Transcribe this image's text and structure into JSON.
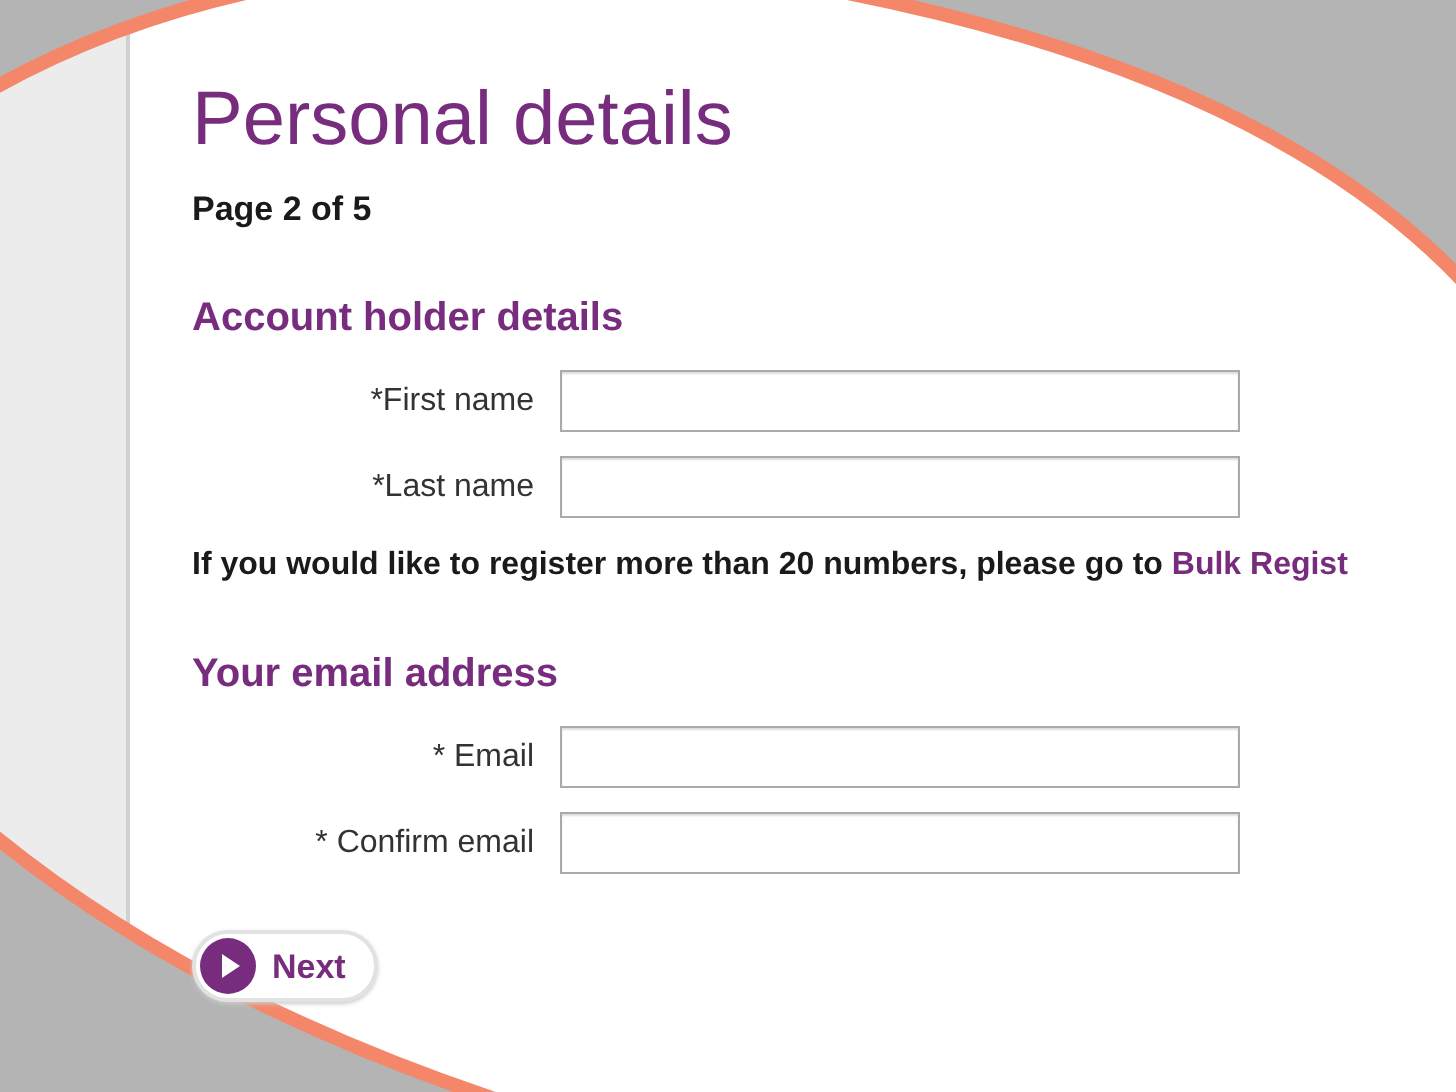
{
  "title": "Personal details",
  "page_indicator": "Page 2 of 5",
  "sections": [
    {
      "heading": "Account holder details",
      "fields": [
        {
          "label": "*First name"
        },
        {
          "label": "*Last name"
        }
      ],
      "note": {
        "text": "If you would like to register more than 20 numbers, please go to",
        "link": "Bulk Regist"
      }
    },
    {
      "heading": "Your email address",
      "fields": [
        {
          "label": "* Email"
        },
        {
          "label": "* Confirm email"
        }
      ]
    }
  ],
  "next_button": {
    "label": "Next"
  }
}
